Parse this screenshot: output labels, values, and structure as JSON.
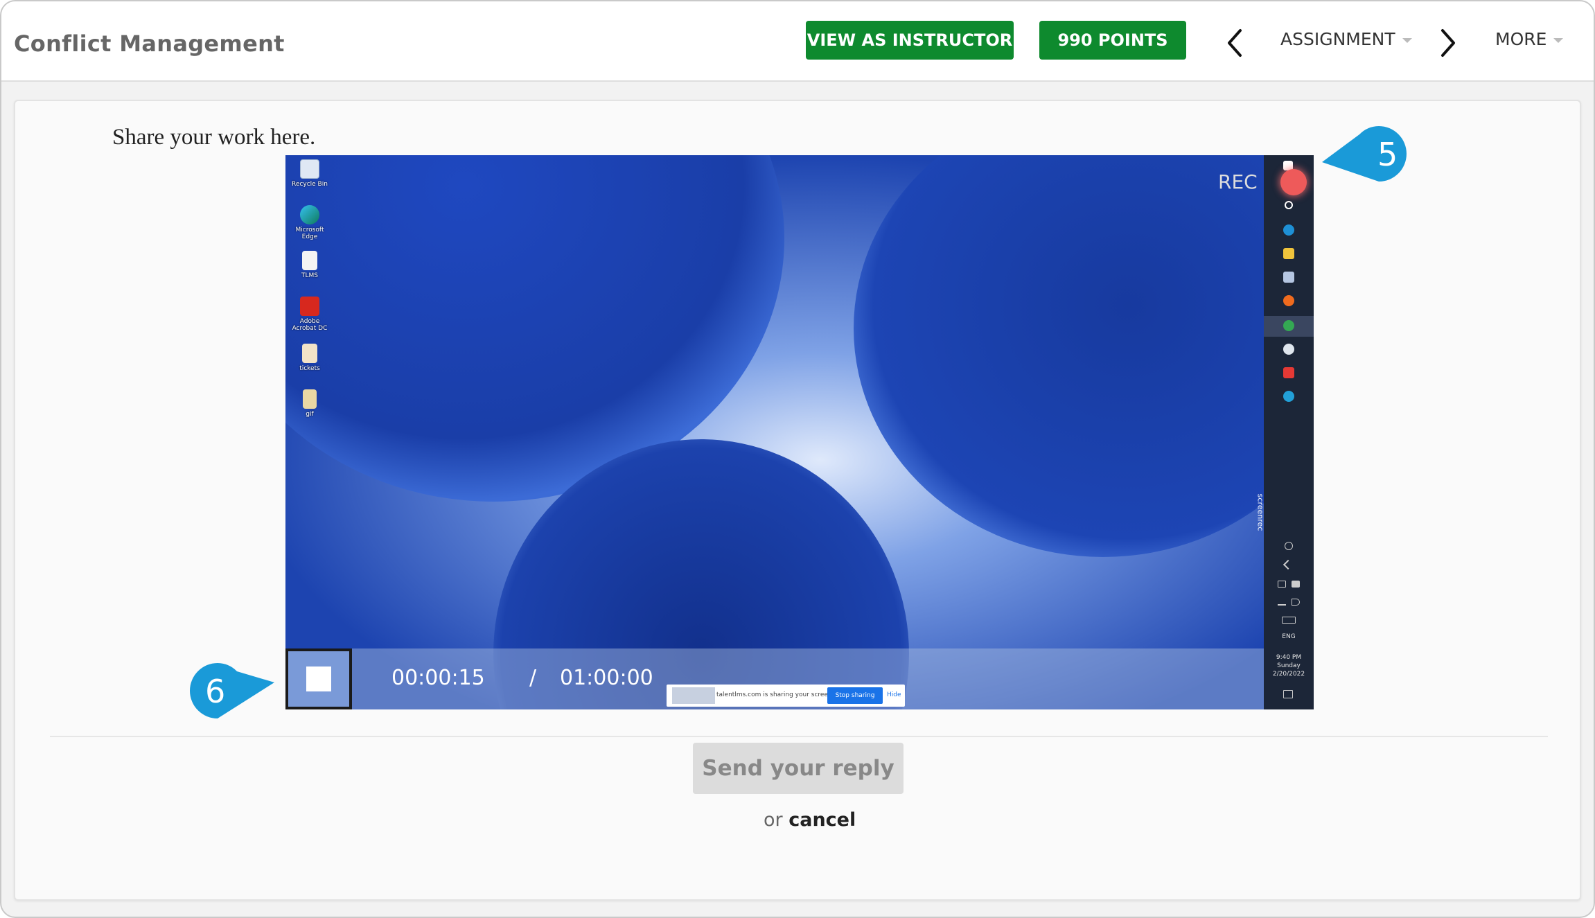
{
  "header": {
    "course_title": "Conflict Management",
    "view_as_instructor": "VIEW AS INSTRUCTOR",
    "points": "990 POINTS",
    "assignment_menu": "ASSIGNMENT",
    "more_menu": "MORE",
    "accent_green": "#0e8a2e"
  },
  "content": {
    "prompt": "Share your work here."
  },
  "recorder": {
    "rec_label": "REC",
    "elapsed": "00:00:15",
    "separator": "/",
    "total": "01:00:00",
    "screenrec_tag": "screenrec",
    "share_notice": "talentlms.com is sharing your screen.",
    "stop_sharing": "Stop sharing",
    "hide": "Hide",
    "desktop_icons": [
      {
        "label": "Recycle Bin",
        "icon": "recycle-bin-icon"
      },
      {
        "label": "Microsoft Edge",
        "icon": "edge-icon"
      },
      {
        "label": "TLMS",
        "icon": "file-icon"
      },
      {
        "label": "Adobe Acrobat DC",
        "icon": "acrobat-icon"
      },
      {
        "label": "tickets",
        "icon": "file-icon"
      },
      {
        "label": "gif",
        "icon": "file-icon"
      }
    ],
    "taskbar": {
      "language": "ENG",
      "time": "9:40 PM",
      "day": "Sunday",
      "date": "2/20/2022"
    }
  },
  "callouts": {
    "step_a": "5",
    "step_b": "6",
    "color": "#1a9ad8"
  },
  "actions": {
    "send_reply": "Send your reply",
    "or": "or",
    "cancel": "cancel"
  }
}
